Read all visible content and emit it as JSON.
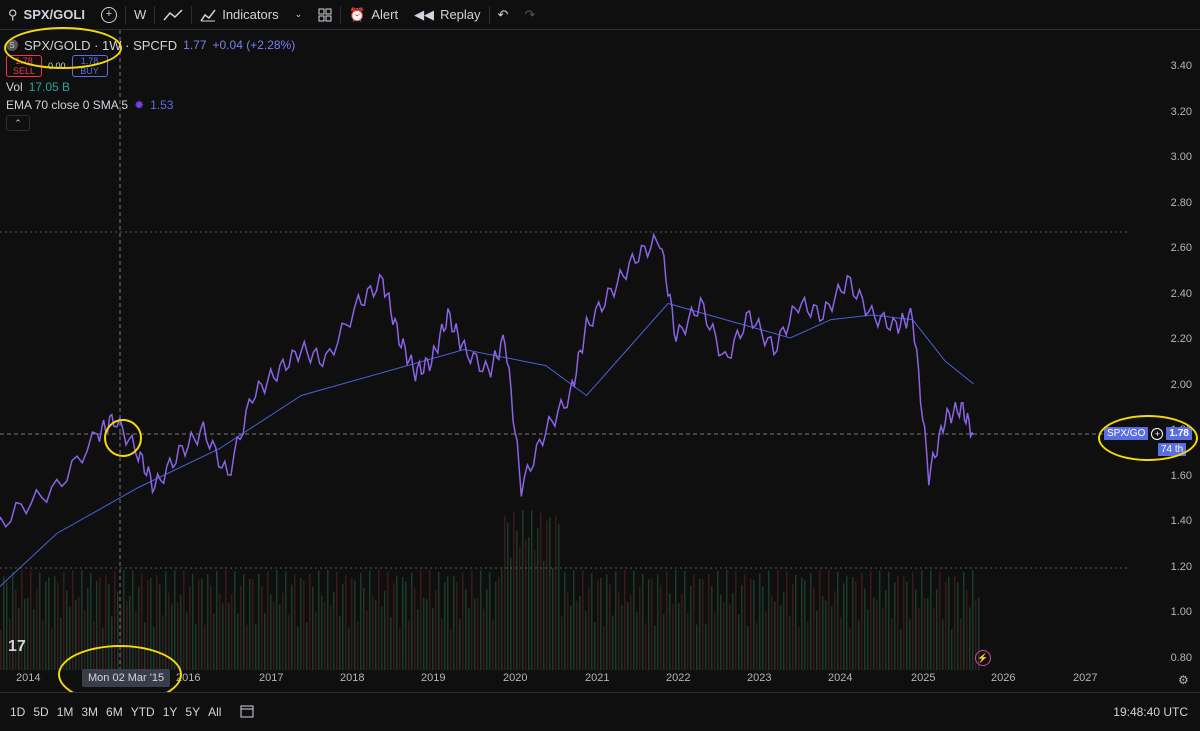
{
  "toolbar": {
    "symbol": "SPX/GOLI",
    "interval": "W",
    "indicators_label": "Indicators",
    "alert_label": "Alert",
    "replay_label": "Replay"
  },
  "legend": {
    "title": "SPX/GOLD · 1W · SPCFD",
    "price": "1.77",
    "change": "+0.04 (+2.28%)",
    "sell_price": "1.78",
    "sell_label": "SELL",
    "spread": "0.00",
    "buy_price": "1.78",
    "buy_label": "BUY",
    "vol_label": "Vol",
    "vol_value": "17.05 B",
    "ema_label": "EMA 70 close 0 SMA 5",
    "ema_value": "1.53"
  },
  "y_axis_labels": [
    "3.40",
    "3.20",
    "3.00",
    "2.80",
    "2.60",
    "2.40",
    "2.20",
    "2.00",
    "1.80",
    "1.60",
    "1.40",
    "1.20",
    "1.00",
    "0.80"
  ],
  "x_axis_labels": [
    "2014",
    "2016",
    "2017",
    "2018",
    "2019",
    "2020",
    "2021",
    "2022",
    "2023",
    "2024",
    "2025",
    "2026",
    "2027"
  ],
  "crosshair_date": "Mon 02 Mar '15",
  "price_tag": {
    "symbol": "SPX/GO",
    "value": "1.78",
    "countdown": "74 th"
  },
  "bottom": {
    "ranges": [
      "1D",
      "5D",
      "1M",
      "3M",
      "6M",
      "YTD",
      "1Y",
      "5Y",
      "All"
    ],
    "clock": "19:48:40 UTC"
  },
  "colors": {
    "price_line": "#8a63e6",
    "ema_line": "#4a61d9",
    "accent": "#5b6ee1",
    "highlight": "#f5d90a"
  },
  "chart_data": {
    "type": "line",
    "ylim": [
      0.8,
      3.4
    ],
    "series": [
      {
        "values_x": [
          2013.5,
          2014.0,
          2014.5,
          2015.0,
          2015.2,
          2015.5,
          2015.7,
          2016.0,
          2016.3,
          2016.6,
          2016.9,
          2017.2,
          2017.5,
          2017.8,
          2018.2,
          2018.5,
          2018.7,
          2018.9,
          2019.1,
          2019.3,
          2019.5,
          2019.8,
          2020.0,
          2020.2,
          2020.5,
          2020.8,
          2021.0,
          2021.3,
          2021.6,
          2021.9,
          2022.1,
          2022.4,
          2022.7,
          2023.0,
          2023.3,
          2023.6,
          2023.9,
          2024.2,
          2024.5,
          2024.8,
          2025.0,
          2025.2,
          2025.4,
          2025.6,
          2025.75
        ],
        "values_y": [
          1.28,
          1.45,
          1.55,
          1.78,
          1.85,
          1.7,
          1.55,
          1.7,
          1.8,
          1.6,
          1.95,
          2.05,
          2.15,
          2.1,
          2.35,
          2.45,
          2.2,
          2.05,
          2.1,
          2.3,
          2.15,
          2.05,
          2.2,
          1.55,
          1.8,
          1.95,
          2.25,
          2.4,
          2.55,
          2.63,
          2.2,
          2.35,
          2.1,
          2.3,
          2.15,
          2.35,
          2.3,
          2.45,
          2.3,
          2.25,
          2.3,
          1.6,
          1.85,
          1.9,
          1.78
        ]
      },
      {
        "values_x": [
          2013.5,
          2014.5,
          2015.5,
          2016.5,
          2017.5,
          2018.5,
          2019.5,
          2020.5,
          2021.0,
          2021.5,
          2022.0,
          2022.5,
          2023.0,
          2023.5,
          2024.0,
          2024.5,
          2025.0,
          2025.4,
          2025.75
        ],
        "values_y": [
          1.02,
          1.35,
          1.55,
          1.72,
          1.95,
          2.05,
          2.15,
          2.08,
          1.95,
          2.15,
          2.35,
          2.3,
          2.25,
          2.2,
          2.28,
          2.3,
          2.28,
          2.1,
          2.0
        ]
      }
    ]
  }
}
